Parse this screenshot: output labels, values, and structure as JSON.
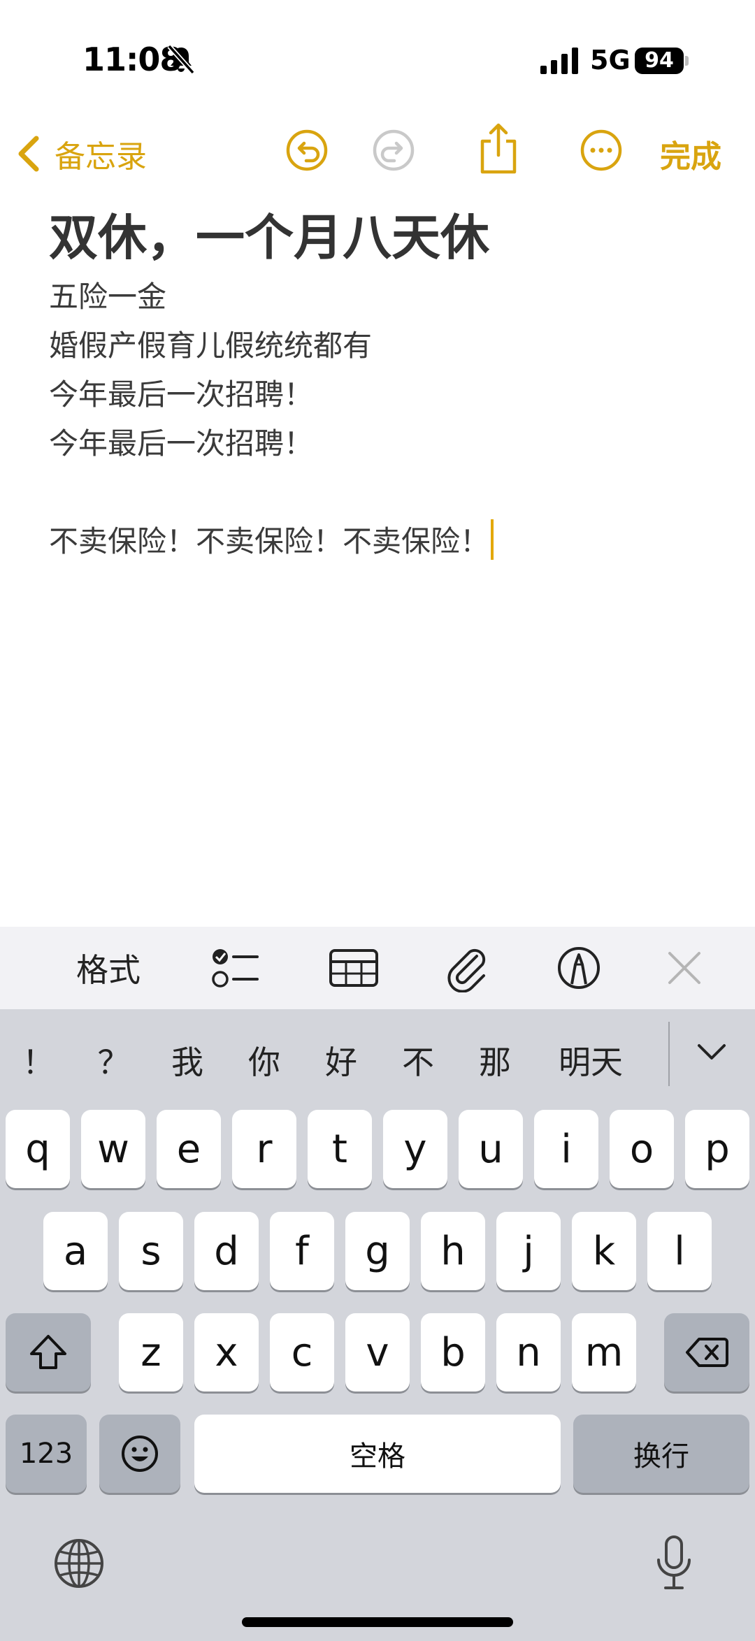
{
  "status_bar": {
    "time": "11:08",
    "network": "5G",
    "battery": "94"
  },
  "nav": {
    "back_label": "备忘录",
    "done_label": "完成"
  },
  "note": {
    "title": "双休，一个月八天休",
    "lines": [
      "五险一金",
      "婚假产假育儿假统统都有",
      "今年最后一次招聘！",
      "今年最后一次招聘！",
      "",
      "不卖保险！不卖保险！不卖保险！"
    ]
  },
  "toolbar": {
    "format_label": "格式"
  },
  "keyboard": {
    "candidates": [
      "！",
      "？",
      "我",
      "你",
      "好",
      "不",
      "那",
      "明天"
    ],
    "row1": [
      "q",
      "w",
      "e",
      "r",
      "t",
      "y",
      "u",
      "i",
      "o",
      "p"
    ],
    "row2": [
      "a",
      "s",
      "d",
      "f",
      "g",
      "h",
      "j",
      "k",
      "l"
    ],
    "row3": [
      "z",
      "x",
      "c",
      "v",
      "b",
      "n",
      "m"
    ],
    "numbers_label": "123",
    "space_label": "空格",
    "return_label": "换行"
  },
  "colors": {
    "accent": "#d9a40f",
    "cursor": "#e3a808",
    "keyboard_bg": "#d3d5db",
    "toolbar_bg": "#f2f2f5"
  },
  "icons": [
    "bell-slash-icon",
    "signal-icon",
    "back-chevron-icon",
    "undo-icon",
    "redo-icon",
    "share-icon",
    "more-icon",
    "checklist-icon",
    "table-icon",
    "paperclip-icon",
    "markup-icon",
    "close-icon",
    "collapse-chevron-icon",
    "shift-icon",
    "delete-icon",
    "emoji-icon",
    "globe-icon",
    "mic-icon"
  ]
}
